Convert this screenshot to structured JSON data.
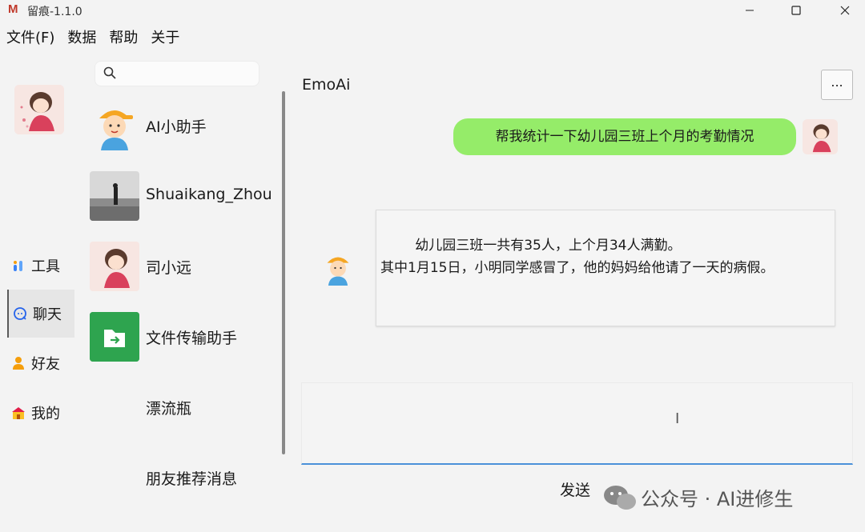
{
  "window": {
    "logo": "M",
    "title": "留痕-1.1.0"
  },
  "menu": [
    "文件(F)",
    "数据",
    "帮助",
    "关于"
  ],
  "nav": [
    {
      "label": "工具",
      "icon": "tools-icon"
    },
    {
      "label": "聊天",
      "icon": "chat-icon",
      "active": true
    },
    {
      "label": "好友",
      "icon": "friends-icon"
    },
    {
      "label": "我的",
      "icon": "home-icon"
    }
  ],
  "search": {
    "placeholder": ""
  },
  "contacts": [
    {
      "name": "AI小助手"
    },
    {
      "name": "Shuaikang_Zhou"
    },
    {
      "name": "司小远"
    },
    {
      "name": "文件传输助手"
    },
    {
      "name": "漂流瓶"
    },
    {
      "name": "朋友推荐消息"
    }
  ],
  "chat": {
    "title": "EmoAi",
    "more_label": "...",
    "outgoing": "帮我统计一下幼儿园三班上个月的考勤情况",
    "incoming": "        幼儿园三班一共有35人，上个月34人满勤。\n其中1月15日，小明同学感冒了，他的妈妈给他请了一天的病假。",
    "input_value": "",
    "send_label": "发送"
  },
  "watermark": "公众号 · AI进修生",
  "colors": {
    "outgoing_bubble": "#95ec69",
    "accent": "#4a90d9"
  }
}
